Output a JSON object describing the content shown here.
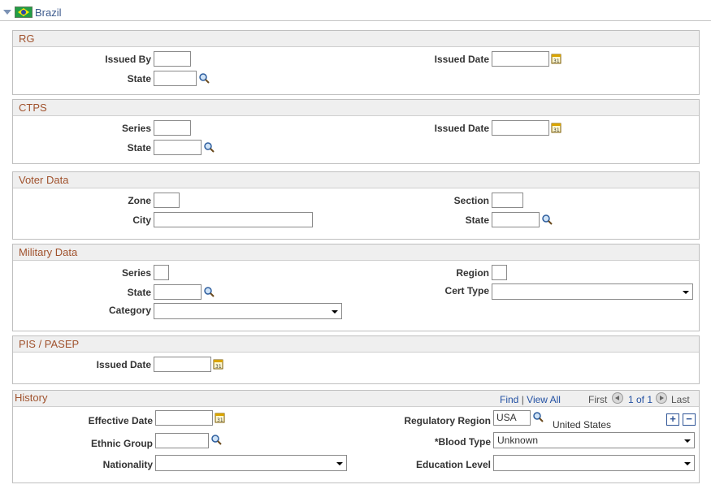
{
  "header": {
    "country": "Brazil"
  },
  "rg": {
    "title": "RG",
    "issued_by": "Issued By",
    "issued_date": "Issued Date",
    "state": "State"
  },
  "ctps": {
    "title": "CTPS",
    "series": "Series",
    "issued_date": "Issued Date",
    "state": "State"
  },
  "voter": {
    "title": "Voter Data",
    "zone": "Zone",
    "section": "Section",
    "city": "City",
    "state": "State"
  },
  "military": {
    "title": "Military Data",
    "series": "Series",
    "region": "Region",
    "state": "State",
    "cert_type": "Cert Type",
    "category": "Category"
  },
  "pis": {
    "title": "PIS / PASEP",
    "issued_date": "Issued Date"
  },
  "history": {
    "title": "History",
    "find": "Find",
    "separator": "|",
    "view_all": "View All",
    "first": "First",
    "page_info": "1 of 1",
    "last": "Last",
    "effective_date": "Effective Date",
    "ethnic_group": "Ethnic Group",
    "nationality": "Nationality",
    "regulatory_region": "Regulatory Region",
    "regulatory_region_value": "USA",
    "regulatory_region_desc": "United States",
    "blood_type": "*Blood Type",
    "blood_type_value": "Unknown",
    "education_level": "Education Level",
    "add_label": "+",
    "remove_label": "−"
  },
  "icons": {
    "lookup": "magnifier-icon",
    "calendar": "calendar-icon",
    "collapse": "triangle-down-icon",
    "flag": "brazil-flag-icon"
  },
  "colors": {
    "section_title": "#a0522d",
    "link": "#2351a3",
    "header_title": "#3c5a8c"
  }
}
